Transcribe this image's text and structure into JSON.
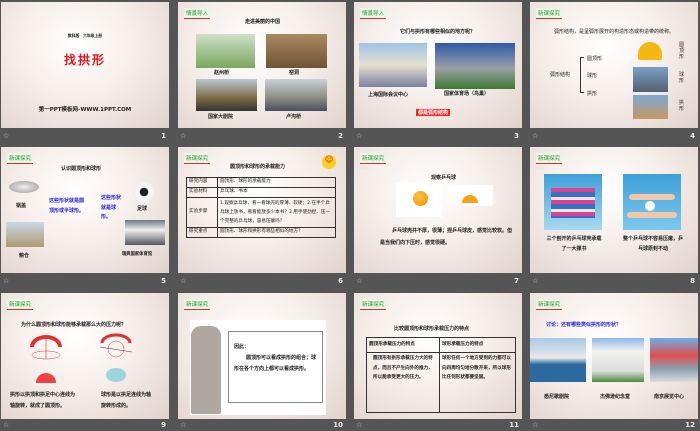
{
  "slides": [
    {
      "number": "1",
      "subtitle": "教科版　六年级上册",
      "title": "找拱形",
      "site": "第一PPT模板网-WWW.1PPT.COM"
    },
    {
      "number": "2",
      "tag": "情景导入",
      "title": "走进美丽的中国",
      "captions": [
        "赵州桥",
        "窑洞",
        "国家大剧院",
        "卢沟桥"
      ]
    },
    {
      "number": "3",
      "tag": "情景导入",
      "question": "它们与拱形有哪些相似的地方呢？",
      "captions": [
        "上海国际会议中心",
        "国家体育场（鸟巢）"
      ],
      "answer": "都是弧形结构"
    },
    {
      "number": "4",
      "tag": "新课探究",
      "definition": "弧形结构，是呈弧形展开的构造形态或构造带的统称。",
      "root": "弧形结构",
      "branches": [
        "圆顶形",
        "球形",
        "拱形"
      ],
      "labels": [
        "圆顶形",
        "球形",
        "拱形"
      ]
    },
    {
      "number": "5",
      "tag": "新课探究",
      "title": "认识圆顶形和球形",
      "items": [
        "锅盖",
        "粮仓",
        "足球",
        "瑞典国家体育馆"
      ],
      "note1": "这些形状就是圆顶形或半球形。",
      "note2": "这些形状就是球形。"
    },
    {
      "number": "6",
      "tag": "新课探究",
      "title": "圆顶形和球形的承载能力",
      "rows": [
        [
          "研究内容",
          "圆顶形、球形的承载能力"
        ],
        [
          "实验材料",
          "乒乓球、书本"
        ],
        [
          "实验步骤",
          "1.观察乒乓球，看一看球壳的厚薄、软硬；2.在半个乒乓球上放书，看看能放多少本书？3.用手使劲捏、压一个完整的乒乓球，容易压瘪吗？"
        ],
        [
          "研究重点",
          "圆顶形、球形和拱形有哪些相似的地方？"
        ]
      ]
    },
    {
      "number": "7",
      "tag": "新课探究",
      "title": "观察乒乓球",
      "text": "乒乓球壳并不厚，很薄；捏乒乓球皮，感觉比较软。但是当我们向下压时，感觉很硬。"
    },
    {
      "number": "8",
      "tag": "新课探究",
      "captions": [
        "三个剖开的乒乓球壳承载了一大摞书",
        "整个乒乓球不容易压瘪，乒乓球原封不动"
      ]
    },
    {
      "number": "9",
      "tag": "新课探究",
      "question": "为什么圆顶形和球形能够承载那么大的压力呢？",
      "left": "拱形以拱顶和拱足中心连线为轴旋转，就成了圆顶形。",
      "right": "球形是以拱足连线为轴旋转形成的。"
    },
    {
      "number": "10",
      "tag": "新课探究",
      "lead": "因此：",
      "text": "圆顶形可以看成拱形的组合；球形在各个方向上都可以看成拱形。"
    },
    {
      "number": "11",
      "tag": "新课探究",
      "title": "比较圆顶形和球形承载压力的特点",
      "headers": [
        "圆顶形承载压力的特点",
        "球形承载压力的特点"
      ],
      "cells": [
        "圆顶形有拱形承载压力大的特点，而且不产生向外的推力，所以能承受更大的压力。",
        "球形任何一个地方受到的力都可以向四周均匀地分散开来，所以球形比任何形状都要坚固。"
      ]
    },
    {
      "number": "12",
      "tag": "新课探究",
      "question": "讨论：还有哪些类似拱形的形状？",
      "captions": [
        "悉尼歌剧院",
        "杰佛逊纪念堂",
        "南京展览中心"
      ]
    }
  ],
  "footer_icon": "star-icon",
  "colors": {
    "background": "#555555",
    "title_red": "#e8141c",
    "tag_green": "#2e9a2e",
    "note_blue": "#2a2ad8"
  }
}
